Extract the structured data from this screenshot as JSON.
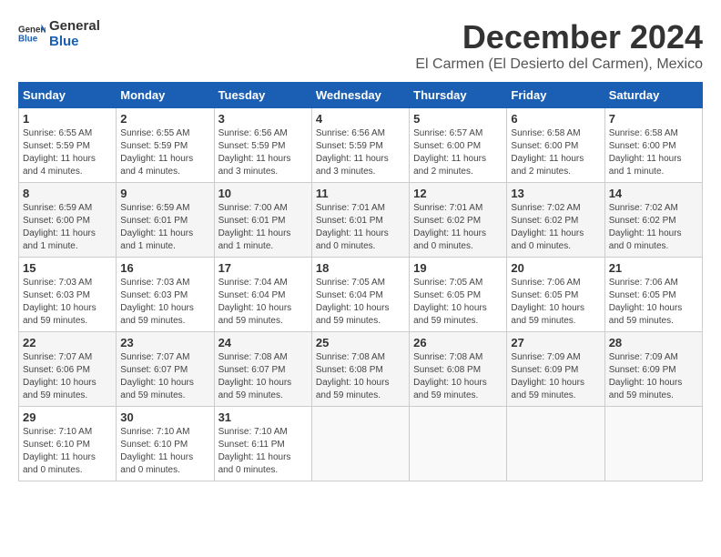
{
  "logo": {
    "line1": "General",
    "line2": "Blue"
  },
  "title": "December 2024",
  "location": "El Carmen (El Desierto del Carmen), Mexico",
  "weekdays": [
    "Sunday",
    "Monday",
    "Tuesday",
    "Wednesday",
    "Thursday",
    "Friday",
    "Saturday"
  ],
  "weeks": [
    [
      {
        "day": "1",
        "info": "Sunrise: 6:55 AM\nSunset: 5:59 PM\nDaylight: 11 hours and 4 minutes."
      },
      {
        "day": "2",
        "info": "Sunrise: 6:55 AM\nSunset: 5:59 PM\nDaylight: 11 hours and 4 minutes."
      },
      {
        "day": "3",
        "info": "Sunrise: 6:56 AM\nSunset: 5:59 PM\nDaylight: 11 hours and 3 minutes."
      },
      {
        "day": "4",
        "info": "Sunrise: 6:56 AM\nSunset: 5:59 PM\nDaylight: 11 hours and 3 minutes."
      },
      {
        "day": "5",
        "info": "Sunrise: 6:57 AM\nSunset: 6:00 PM\nDaylight: 11 hours and 2 minutes."
      },
      {
        "day": "6",
        "info": "Sunrise: 6:58 AM\nSunset: 6:00 PM\nDaylight: 11 hours and 2 minutes."
      },
      {
        "day": "7",
        "info": "Sunrise: 6:58 AM\nSunset: 6:00 PM\nDaylight: 11 hours and 1 minute."
      }
    ],
    [
      {
        "day": "8",
        "info": "Sunrise: 6:59 AM\nSunset: 6:00 PM\nDaylight: 11 hours and 1 minute."
      },
      {
        "day": "9",
        "info": "Sunrise: 6:59 AM\nSunset: 6:01 PM\nDaylight: 11 hours and 1 minute."
      },
      {
        "day": "10",
        "info": "Sunrise: 7:00 AM\nSunset: 6:01 PM\nDaylight: 11 hours and 1 minute."
      },
      {
        "day": "11",
        "info": "Sunrise: 7:01 AM\nSunset: 6:01 PM\nDaylight: 11 hours and 0 minutes."
      },
      {
        "day": "12",
        "info": "Sunrise: 7:01 AM\nSunset: 6:02 PM\nDaylight: 11 hours and 0 minutes."
      },
      {
        "day": "13",
        "info": "Sunrise: 7:02 AM\nSunset: 6:02 PM\nDaylight: 11 hours and 0 minutes."
      },
      {
        "day": "14",
        "info": "Sunrise: 7:02 AM\nSunset: 6:02 PM\nDaylight: 11 hours and 0 minutes."
      }
    ],
    [
      {
        "day": "15",
        "info": "Sunrise: 7:03 AM\nSunset: 6:03 PM\nDaylight: 10 hours and 59 minutes."
      },
      {
        "day": "16",
        "info": "Sunrise: 7:03 AM\nSunset: 6:03 PM\nDaylight: 10 hours and 59 minutes."
      },
      {
        "day": "17",
        "info": "Sunrise: 7:04 AM\nSunset: 6:04 PM\nDaylight: 10 hours and 59 minutes."
      },
      {
        "day": "18",
        "info": "Sunrise: 7:05 AM\nSunset: 6:04 PM\nDaylight: 10 hours and 59 minutes."
      },
      {
        "day": "19",
        "info": "Sunrise: 7:05 AM\nSunset: 6:05 PM\nDaylight: 10 hours and 59 minutes."
      },
      {
        "day": "20",
        "info": "Sunrise: 7:06 AM\nSunset: 6:05 PM\nDaylight: 10 hours and 59 minutes."
      },
      {
        "day": "21",
        "info": "Sunrise: 7:06 AM\nSunset: 6:05 PM\nDaylight: 10 hours and 59 minutes."
      }
    ],
    [
      {
        "day": "22",
        "info": "Sunrise: 7:07 AM\nSunset: 6:06 PM\nDaylight: 10 hours and 59 minutes."
      },
      {
        "day": "23",
        "info": "Sunrise: 7:07 AM\nSunset: 6:07 PM\nDaylight: 10 hours and 59 minutes."
      },
      {
        "day": "24",
        "info": "Sunrise: 7:08 AM\nSunset: 6:07 PM\nDaylight: 10 hours and 59 minutes."
      },
      {
        "day": "25",
        "info": "Sunrise: 7:08 AM\nSunset: 6:08 PM\nDaylight: 10 hours and 59 minutes."
      },
      {
        "day": "26",
        "info": "Sunrise: 7:08 AM\nSunset: 6:08 PM\nDaylight: 10 hours and 59 minutes."
      },
      {
        "day": "27",
        "info": "Sunrise: 7:09 AM\nSunset: 6:09 PM\nDaylight: 10 hours and 59 minutes."
      },
      {
        "day": "28",
        "info": "Sunrise: 7:09 AM\nSunset: 6:09 PM\nDaylight: 10 hours and 59 minutes."
      }
    ],
    [
      {
        "day": "29",
        "info": "Sunrise: 7:10 AM\nSunset: 6:10 PM\nDaylight: 11 hours and 0 minutes."
      },
      {
        "day": "30",
        "info": "Sunrise: 7:10 AM\nSunset: 6:10 PM\nDaylight: 11 hours and 0 minutes."
      },
      {
        "day": "31",
        "info": "Sunrise: 7:10 AM\nSunset: 6:11 PM\nDaylight: 11 hours and 0 minutes."
      },
      {
        "day": "",
        "info": ""
      },
      {
        "day": "",
        "info": ""
      },
      {
        "day": "",
        "info": ""
      },
      {
        "day": "",
        "info": ""
      }
    ]
  ]
}
